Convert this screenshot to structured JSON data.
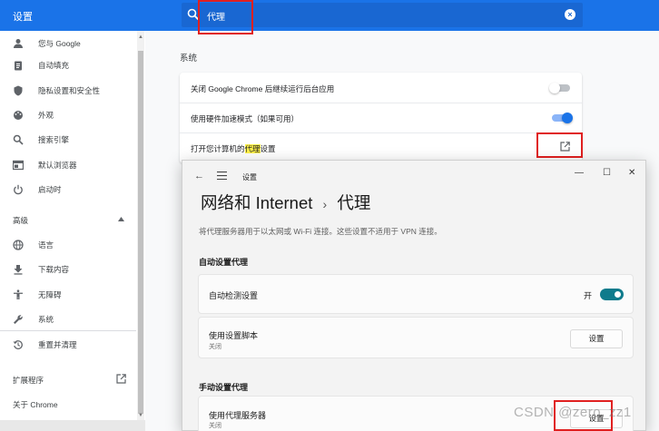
{
  "header": {
    "title": "设置",
    "search_value": "代理"
  },
  "sidebar": {
    "items": [
      {
        "label": "您与 Google",
        "icon": "person-icon"
      },
      {
        "label": "自动填充",
        "icon": "clipboard-icon"
      },
      {
        "label": "隐私设置和安全性",
        "icon": "shield-icon"
      },
      {
        "label": "外观",
        "icon": "palette-icon"
      },
      {
        "label": "搜索引擎",
        "icon": "search-icon"
      },
      {
        "label": "默认浏览器",
        "icon": "browser-icon"
      },
      {
        "label": "启动时",
        "icon": "power-icon"
      }
    ],
    "advanced_label": "高级",
    "advanced_items": [
      {
        "label": "语言",
        "icon": "globe-icon"
      },
      {
        "label": "下载内容",
        "icon": "download-icon"
      },
      {
        "label": "无障碍",
        "icon": "accessibility-icon"
      },
      {
        "label": "系统",
        "icon": "wrench-icon"
      },
      {
        "label": "重置并清理",
        "icon": "reset-icon"
      }
    ],
    "extensions_label": "扩展程序",
    "about_label": "关于 Chrome"
  },
  "main": {
    "section_title": "系统",
    "rows": {
      "background_apps": "关闭 Google Chrome 后继续运行后台应用",
      "hw_accel": "使用硬件加速模式（如果可用）",
      "proxy_prefix": "打开您计算机的",
      "proxy_highlight": "代理",
      "proxy_suffix": "设置"
    },
    "toggles": {
      "background_apps": false,
      "hw_accel": true
    }
  },
  "dialog": {
    "window_title": "设置",
    "breadcrumb_parent": "网络和 Internet",
    "breadcrumb_sep": "›",
    "breadcrumb_current": "代理",
    "description": "将代理服务器用于以太网或 Wi-Fi 连接。这些设置不适用于 VPN 连接。",
    "auto_section": "自动设置代理",
    "auto_detect_label": "自动检测设置",
    "auto_detect_state": "开",
    "script_label": "使用设置脚本",
    "script_status": "关闭",
    "script_button": "设置",
    "manual_section": "手动设置代理",
    "proxy_server_label": "使用代理服务器",
    "proxy_server_status": "关闭",
    "proxy_server_button": "设置"
  },
  "watermark": "CSDN @zero_zz1",
  "colors": {
    "accent": "#1a73e8",
    "win_accent": "#0f7b8c",
    "highlight_red": "#e02020"
  }
}
